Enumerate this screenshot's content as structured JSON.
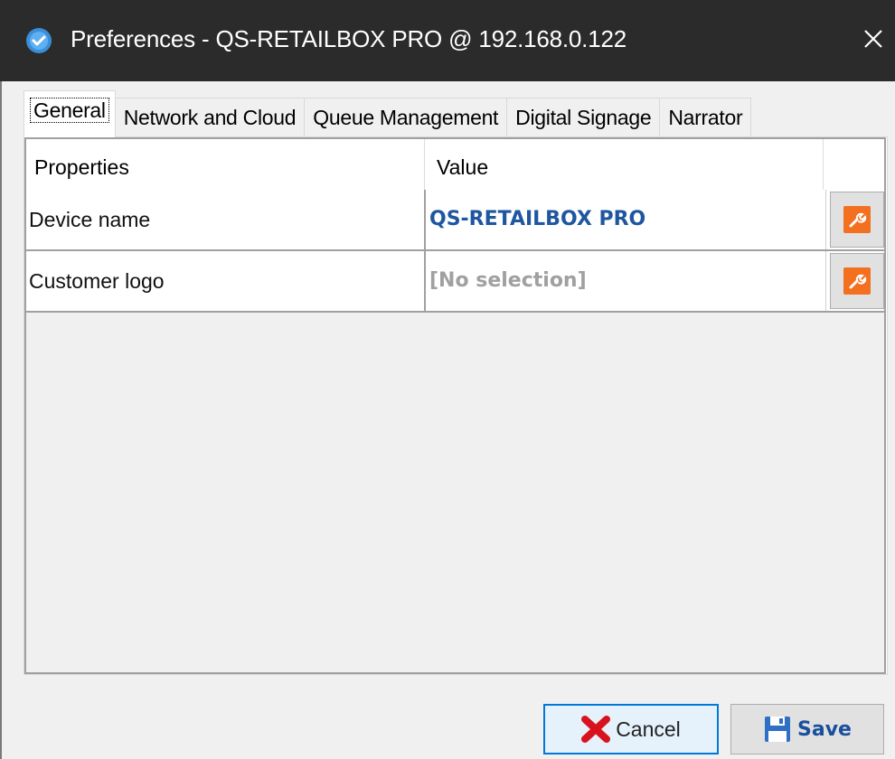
{
  "window": {
    "title": "Preferences - QS-RETAILBOX PRO @ 192.168.0.122",
    "app_icon": "shield-check-icon",
    "close_icon": "close-icon"
  },
  "tabs": [
    {
      "label": "General",
      "active": true
    },
    {
      "label": "Network and Cloud",
      "active": false
    },
    {
      "label": "Queue Management",
      "active": false
    },
    {
      "label": "Digital Signage",
      "active": false
    },
    {
      "label": "Narrator",
      "active": false
    }
  ],
  "grid": {
    "columns": [
      "Properties",
      "Value"
    ],
    "rows": [
      {
        "name": "Device name",
        "value": "QS-RETAILBOX PRO",
        "value_color": "#1e56a0",
        "action_icon": "wrench-icon"
      },
      {
        "name": "Customer logo",
        "value": "[No selection]",
        "value_color": "#a0a0a0",
        "action_icon": "wrench-icon"
      }
    ]
  },
  "footer": {
    "cancel_label": "Cancel",
    "cancel_icon": "red-x-icon",
    "save_label": "Save",
    "save_icon": "floppy-disk-icon"
  },
  "colors": {
    "titlebar": "#2b2b2b",
    "accent_orange": "#f37021",
    "focus_blue": "#0078d7",
    "value_blue": "#1e56a0",
    "placeholder_gray": "#a0a0a0"
  }
}
